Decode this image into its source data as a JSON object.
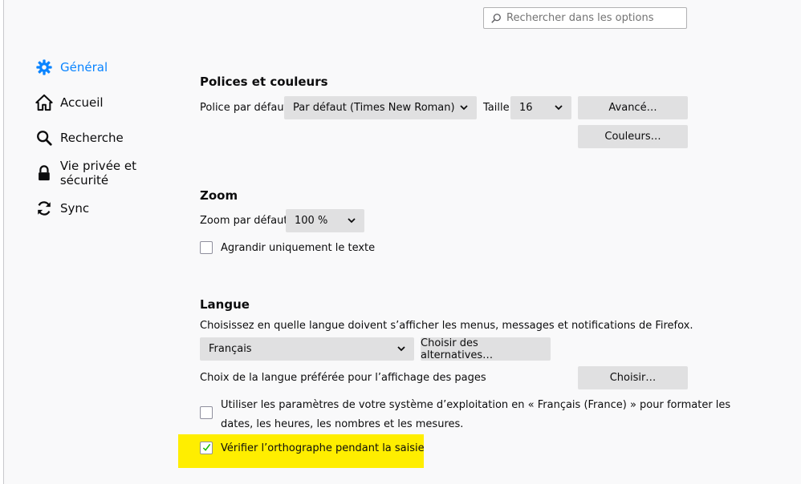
{
  "search": {
    "placeholder": "Rechercher dans les options"
  },
  "sidebar": {
    "items": [
      {
        "label": "Général",
        "icon": "gear-icon",
        "active": true
      },
      {
        "label": "Accueil",
        "icon": "home-icon"
      },
      {
        "label": "Recherche",
        "icon": "search-icon"
      },
      {
        "label": "Vie privée et sécurité",
        "icon": "lock-icon"
      },
      {
        "label": "Sync",
        "icon": "sync-icon"
      }
    ]
  },
  "fonts": {
    "heading": "Polices et couleurs",
    "default_font_label": "Police par défaut",
    "default_font_value": "Par défaut (Times New Roman)",
    "size_label": "Taille",
    "size_value": "16",
    "advanced_button": "Avancé…",
    "colors_button": "Couleurs…"
  },
  "zoom": {
    "heading": "Zoom",
    "default_zoom_label": "Zoom par défaut",
    "default_zoom_value": "100 %",
    "text_only_label": "Agrandir uniquement le texte",
    "text_only_checked": false
  },
  "language": {
    "heading": "Langue",
    "description": "Choisissez en quelle langue doivent s’afficher les menus, messages et notifications de Firefox.",
    "ui_language_value": "Français",
    "alternatives_button": "Choisir des alternatives…",
    "page_language_label": "Choix de la langue préférée pour l’affichage des pages",
    "choose_button": "Choisir…",
    "os_locale_label_line1": "Utiliser les paramètres de votre système d’exploitation en « Français (France) » pour formater les",
    "os_locale_label_line2": "dates, les heures, les nombres et les mesures.",
    "os_locale_checked": false,
    "spellcheck_label": "Vérifier l’orthographe pendant la saisie",
    "spellcheck_checked": true
  },
  "colors": {
    "accent": "#0a84ff",
    "highlight": "#ffee00",
    "check": "#12bc00"
  }
}
